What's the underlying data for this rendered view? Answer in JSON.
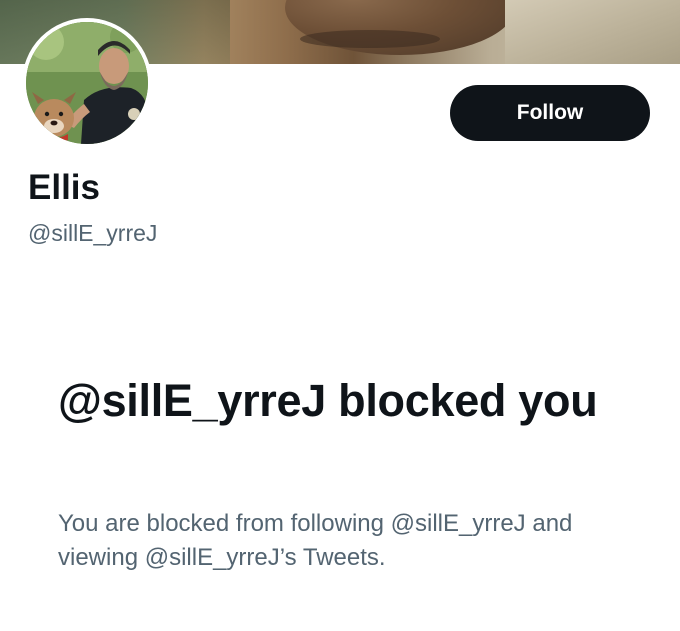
{
  "profile": {
    "display_name": "Ellis",
    "handle": "@sillE_yrreJ",
    "follow_label": "Follow"
  },
  "blocked": {
    "title": "@sillE_yrreJ blocked you",
    "description": "You are blocked from following @sillE_yrreJ and viewing @sillE_yrreJ’s Tweets."
  },
  "colors": {
    "button_bg": "#0f1419",
    "text_primary": "#0f1419",
    "text_secondary": "#536471"
  }
}
